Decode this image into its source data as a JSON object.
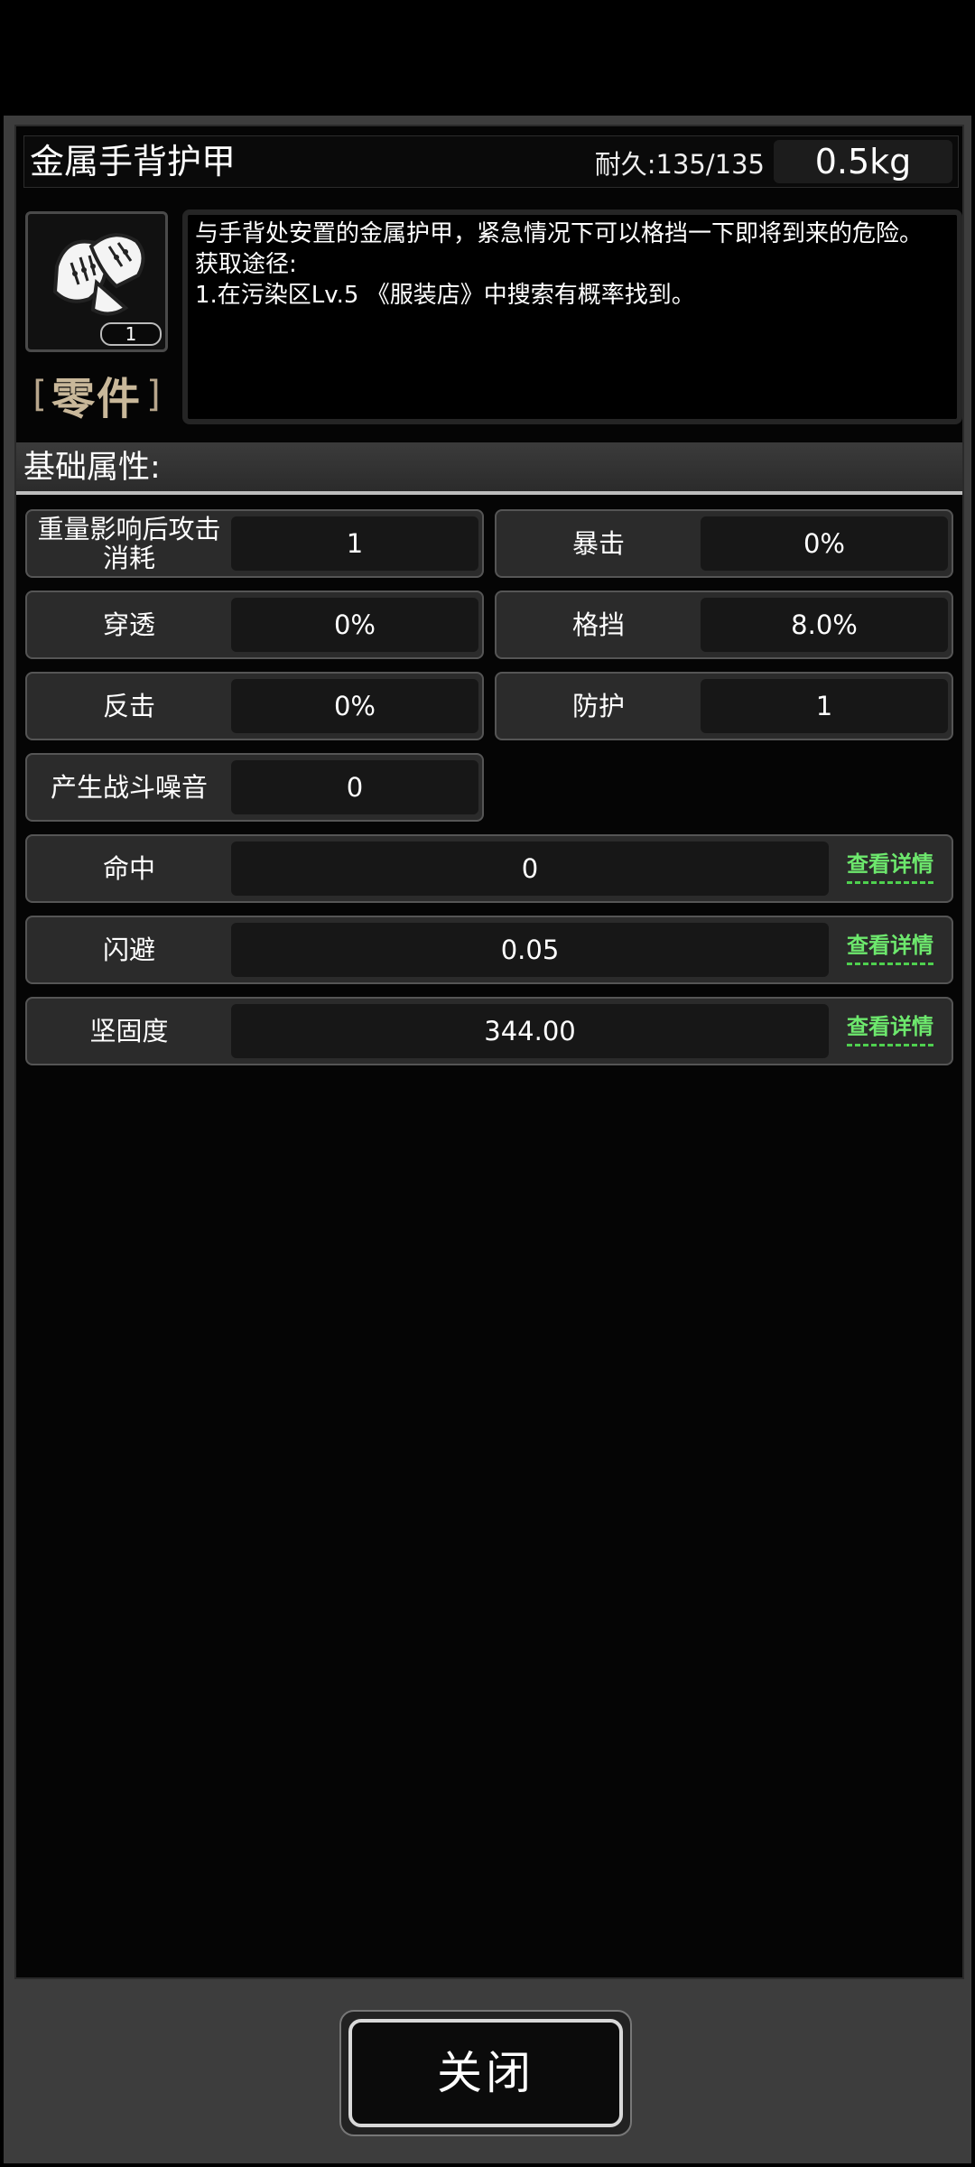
{
  "item": {
    "name": "金属手背护甲",
    "durability": "耐久:135/135",
    "weight": "0.5kg",
    "quantity": "1",
    "category_open": "[",
    "category": "零件",
    "category_close": "]",
    "icon": "metal-gauntlet-icon"
  },
  "description": {
    "line1": "与手背处安置的金属护甲，紧急情况下可以格挡一下即将到来的危险。",
    "line2": "获取途径:",
    "line3": "1.在污染区Lv.5 《服装店》中搜索有概率找到。"
  },
  "section": {
    "title": "基础属性:"
  },
  "stats": {
    "weight_cost": {
      "label": "重量影响后攻击消耗",
      "value": "1"
    },
    "crit": {
      "label": "暴击",
      "value": "0%"
    },
    "pierce": {
      "label": "穿透",
      "value": "0%"
    },
    "block": {
      "label": "格挡",
      "value": "8.0%"
    },
    "counter": {
      "label": "反击",
      "value": "0%"
    },
    "defense": {
      "label": "防护",
      "value": "1"
    },
    "noise": {
      "label": "产生战斗噪音",
      "value": "0"
    },
    "hit": {
      "label": "命中",
      "value": "0",
      "link": "查看详情"
    },
    "dodge": {
      "label": "闪避",
      "value": "0.05",
      "link": "查看详情"
    },
    "toughness": {
      "label": "坚固度",
      "value": "344.00",
      "link": "查看详情"
    }
  },
  "footer": {
    "close_label": "关闭"
  },
  "colors": {
    "link_green": "#6de86d",
    "category_gold": "#c9b89a"
  }
}
